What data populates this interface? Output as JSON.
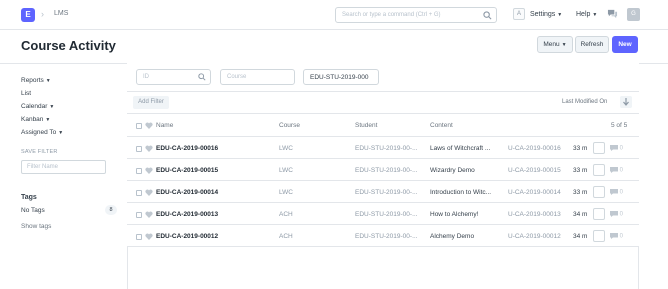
{
  "navbar": {
    "logo_letter": "E",
    "breadcrumb_sep": "›",
    "breadcrumb": "LMS",
    "search_placeholder": "Search or type a command (Ctrl + G)",
    "avatar_initial_a": "A",
    "settings_label": "Settings",
    "help_label": "Help",
    "user_initial": "G"
  },
  "header": {
    "title": "Course Activity",
    "menu_label": "Menu",
    "refresh_label": "Refresh",
    "new_label": "New"
  },
  "sidebar": {
    "reports": "Reports",
    "list": "List",
    "calendar": "Calendar",
    "kanban": "Kanban",
    "assigned_to": "Assigned To",
    "save_filter_label": "SAVE FILTER",
    "filter_name_placeholder": "Filter Name",
    "tags_heading": "Tags",
    "no_tags": "No Tags",
    "no_tags_count": "8",
    "show_tags": "Show tags"
  },
  "filters": {
    "id_placeholder": "ID",
    "course_placeholder": "Course",
    "student_value": "EDU-STU-2019-000"
  },
  "list_controls": {
    "add_filter": "Add Filter",
    "sort_label": "Last Modified On"
  },
  "table": {
    "headers": {
      "name": "Name",
      "course": "Course",
      "student": "Student",
      "content": "Content",
      "count": "5 of 5"
    },
    "rows": [
      {
        "name": "EDU-CA-2019-00016",
        "course": "LWC",
        "student": "EDU-STU-2019-00-...",
        "content": "Laws of Witchcraft ...",
        "ref": "U-CA-2019-00016",
        "time": "33 m",
        "comments": "0"
      },
      {
        "name": "EDU-CA-2019-00015",
        "course": "LWC",
        "student": "EDU-STU-2019-00-...",
        "content": "Wizardry Demo",
        "ref": "U-CA-2019-00015",
        "time": "33 m",
        "comments": "0"
      },
      {
        "name": "EDU-CA-2019-00014",
        "course": "LWC",
        "student": "EDU-STU-2019-00-...",
        "content": "Introduction to Witc...",
        "ref": "U-CA-2019-00014",
        "time": "33 m",
        "comments": "0"
      },
      {
        "name": "EDU-CA-2019-00013",
        "course": "ACH",
        "student": "EDU-STU-2019-00-...",
        "content": "How to Alchemy!",
        "ref": "U-CA-2019-00013",
        "time": "34 m",
        "comments": "0"
      },
      {
        "name": "EDU-CA-2019-00012",
        "course": "ACH",
        "student": "EDU-STU-2019-00-...",
        "content": "Alchemy Demo",
        "ref": "U-CA-2019-00012",
        "time": "34 m",
        "comments": "0"
      }
    ]
  },
  "colors": {
    "brand": "#5e64ff",
    "border": "#e3e6ea",
    "text": "#36414c",
    "muted": "#8d99a6"
  }
}
